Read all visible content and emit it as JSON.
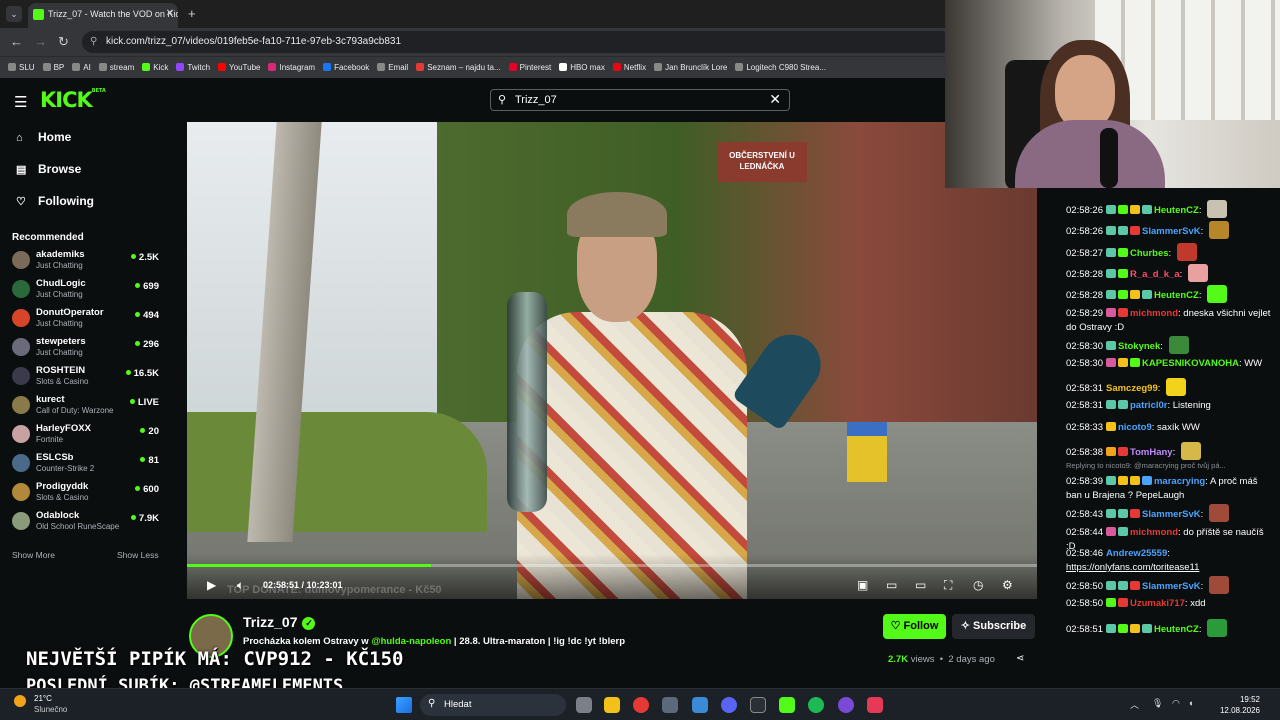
{
  "browser": {
    "tab_title": "Trizz_07 - Watch the VOD on Kick",
    "url": "kick.com/trizz_07/videos/019feb5e-fa10-711e-97eb-3c793a9cb831",
    "bookmarks": [
      "SLU",
      "BP",
      "AI",
      "stream",
      "Kick",
      "Twitch",
      "YouTube",
      "Instagram",
      "Facebook",
      "Email",
      "Seznam – najdu ta...",
      "Pinterest",
      "HBO max",
      "Netflix",
      "Jan Brunclík Lore",
      "Logitech C980 Strea..."
    ]
  },
  "header": {
    "logo": "KICK",
    "logo_badge": "BETA",
    "search_value": "Trizz_07"
  },
  "sidebar": {
    "nav": [
      {
        "label": "Home",
        "icon": "home-icon"
      },
      {
        "label": "Browse",
        "icon": "browse-icon"
      },
      {
        "label": "Following",
        "icon": "heart-icon"
      }
    ],
    "recommended_title": "Recommended",
    "recommended": [
      {
        "name": "akademiks",
        "category": "Just Chatting",
        "viewers": "2.5K"
      },
      {
        "name": "ChudLogic",
        "category": "Just Chatting",
        "viewers": "699"
      },
      {
        "name": "DonutOperator",
        "category": "Just Chatting",
        "viewers": "494"
      },
      {
        "name": "stewpeters",
        "category": "Just Chatting",
        "viewers": "296"
      },
      {
        "name": "ROSHTEIN",
        "category": "Slots & Casino",
        "viewers": "16.5K"
      },
      {
        "name": "kurect",
        "category": "Call of Duty: Warzone",
        "viewers": "LIVE"
      },
      {
        "name": "HarleyFOXX",
        "category": "Fortnite",
        "viewers": "20"
      },
      {
        "name": "ESLCSb",
        "category": "Counter-Strike 2",
        "viewers": "81"
      },
      {
        "name": "Prodigyddk",
        "category": "Slots & Casino",
        "viewers": "600"
      },
      {
        "name": "Odablock",
        "category": "Old School RuneScape",
        "viewers": "7.9K"
      }
    ],
    "show_more": "Show More",
    "show_less": "Show Less"
  },
  "video": {
    "sign_text": "OBČERSTVENÍ U LEDNÁČKA",
    "time": "02:58:51 / 10:23:01",
    "progress": 0.287,
    "watermark": "TOP DONATE: dumovypomerance - Kč50"
  },
  "channel": {
    "name": "Trizz_07",
    "title_prefix": "Procházka kolem Ostravy w ",
    "mention": "@hulda-napoleon",
    "title_suffix": " | 28.8. Ultra-maraton | !ig !dc !yt !blerp",
    "follow_label": "Follow",
    "subscribe_label": "Subscribe",
    "views": "2.7K",
    "views_label": " views",
    "date": "2 days ago"
  },
  "overlay": {
    "line1": "NEJVĚTŠÍ PIPÍK MÁ: CVP912 - KČ150",
    "line2": "POSLEDNÍ SUBÍK: @STREAMELEMENTS"
  },
  "chat": {
    "messages": [
      {
        "time": "02:58:26",
        "user": "HeutenCZ",
        "color": "#53fc18",
        "text": "",
        "emote": "#c9c2b0",
        "badges": [
          "#5cc8a8",
          "#53fc18",
          "#f2c21b",
          "#5cc8a8"
        ]
      },
      {
        "time": "02:58:26",
        "user": "SlammerSvK",
        "color": "#4aa3ff",
        "text": "",
        "emote": "#b8862a",
        "badges": [
          "#5cc8a8",
          "#5cc8a8",
          "#e53935"
        ]
      },
      {
        "time": "02:58:27",
        "user": "Churbes",
        "color": "#53fc18",
        "text": "",
        "emote": "#c0392b",
        "badges": [
          "#5cc8a8",
          "#53fc18"
        ]
      },
      {
        "time": "02:58:28",
        "user": "R_a_d_k_a",
        "color": "#ff4d6d",
        "text": "",
        "emote": "#e8a0a0",
        "badges": [
          "#5cc8a8",
          "#53fc18"
        ]
      },
      {
        "time": "02:58:28",
        "user": "HeutenCZ",
        "color": "#53fc18",
        "text": "",
        "emote": "#53fc18",
        "badges": [
          "#5cc8a8",
          "#53fc18",
          "#f2c21b",
          "#5cc8a8"
        ]
      },
      {
        "time": "02:58:29",
        "user": "michmond",
        "color": "#e53935",
        "text": "dneska všichni vejlet do Ostravy :D",
        "emote": "",
        "badges": [
          "#d65a9c",
          "#e53935"
        ]
      },
      {
        "time": "02:58:30",
        "user": "Stokynek",
        "color": "#53fc18",
        "text": "",
        "emote": "#3a8a3a",
        "badges": [
          "#5cc8a8"
        ]
      },
      {
        "time": "02:58:30",
        "user": "KAPESNIKOVANOHA",
        "color": "#53fc18",
        "text": "WW",
        "emote": "",
        "badges": [
          "#d65a9c",
          "#f2c21b",
          "#53fc18"
        ]
      },
      {
        "time": "02:58:31",
        "user": "Samczeg99",
        "color": "#f2c21b",
        "text": "",
        "emote": "#f2d21b",
        "badges": []
      },
      {
        "time": "02:58:31",
        "user": "patricl0r",
        "color": "#4aa3ff",
        "text": "Listening",
        "emote": "",
        "badges": [
          "#5cc8a8",
          "#5cc8a8"
        ]
      },
      {
        "time": "02:58:33",
        "user": "nicoto9",
        "color": "#4aa3ff",
        "text": "saxík WW",
        "emote": "",
        "badges": [
          "#f2c21b"
        ]
      },
      {
        "time": "02:58:38",
        "user": "TomHany",
        "color": "#c08aff",
        "text": "",
        "emote": "#d6b84a",
        "badges": [
          "#f2a31b",
          "#e53935"
        ]
      },
      {
        "time": "02:58:39",
        "user": "maracrying",
        "color": "#4aa3ff",
        "text": "A proč máš ban u Brajena ? PepeLaugh",
        "emote": "",
        "badges": [
          "#5cc8a8",
          "#f2c21b",
          "#f2c21b",
          "#4aa3ff"
        ]
      },
      {
        "time": "02:58:43",
        "user": "SlammerSvK",
        "color": "#4aa3ff",
        "text": "",
        "emote": "#a04a3a",
        "badges": [
          "#5cc8a8",
          "#5cc8a8",
          "#e53935"
        ]
      },
      {
        "time": "02:58:44",
        "user": "michmond",
        "color": "#e53935",
        "text": "do příště se naučíš :D",
        "emote": "",
        "badges": [
          "#d65a9c",
          "#5cc8a8"
        ]
      },
      {
        "time": "02:58:46",
        "user": "Andrew25559",
        "color": "#4aa3ff",
        "text": "https://onlyfans.com/toriteasе11",
        "emote": "",
        "badges": []
      },
      {
        "time": "02:58:50",
        "user": "SlammerSvK",
        "color": "#4aa3ff",
        "text": "",
        "emote": "#a04a3a",
        "badges": [
          "#5cc8a8",
          "#5cc8a8",
          "#e53935"
        ]
      },
      {
        "time": "02:58:50",
        "user": "Uzumaki717",
        "color": "#e53935",
        "text": "xdd",
        "emote": "",
        "badges": [
          "#53fc18",
          "#e53935"
        ]
      },
      {
        "time": "02:58:51",
        "user": "HeutenCZ",
        "color": "#53fc18",
        "text": "",
        "emote": "#2a9a3a",
        "badges": [
          "#5cc8a8",
          "#53fc18",
          "#f2c21b",
          "#5cc8a8"
        ]
      }
    ],
    "reply_text": "Replying to nicoto9: @maracrying proč tvůj pá..."
  },
  "taskbar": {
    "temperature": "21°C",
    "condition": "Slunečno",
    "search_placeholder": "Hledat",
    "time": "19:52",
    "date": "12.08.2026"
  }
}
